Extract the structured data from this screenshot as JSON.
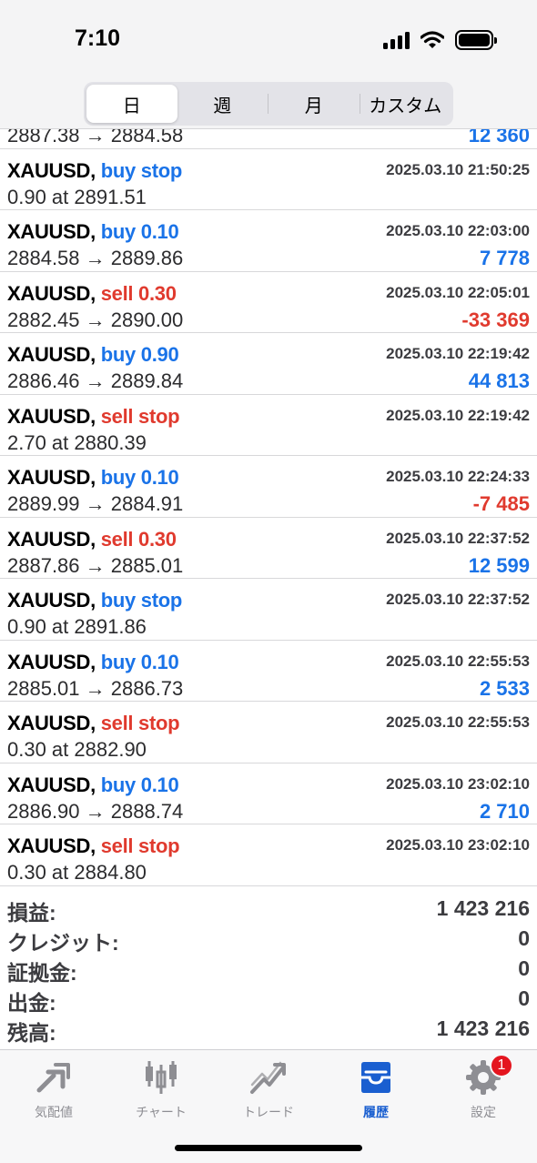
{
  "status_bar": {
    "time": "7:10"
  },
  "segments": [
    {
      "label": "日",
      "active": true
    },
    {
      "label": "週",
      "active": false
    },
    {
      "label": "月",
      "active": false
    },
    {
      "label": "カスタム",
      "active": false
    }
  ],
  "partial_row": {
    "detail": "2887.38 → 2884.58",
    "profit": "12 360"
  },
  "rows": [
    {
      "symbol": "XAUUSD,",
      "side": "buy stop",
      "side_type": "buy",
      "time": "2025.03.10 21:50:25",
      "detail": "0.90 at 2891.51",
      "profit": "",
      "profit_sign": ""
    },
    {
      "symbol": "XAUUSD,",
      "side": "buy 0.10",
      "side_type": "buy",
      "time": "2025.03.10 22:03:00",
      "detail": "2884.58 → 2889.86",
      "profit": "7 778",
      "profit_sign": "pos"
    },
    {
      "symbol": "XAUUSD,",
      "side": "sell 0.30",
      "side_type": "sell",
      "time": "2025.03.10 22:05:01",
      "detail": "2882.45 → 2890.00",
      "profit": "-33 369",
      "profit_sign": "neg"
    },
    {
      "symbol": "XAUUSD,",
      "side": "buy 0.90",
      "side_type": "buy",
      "time": "2025.03.10 22:19:42",
      "detail": "2886.46 → 2889.84",
      "profit": "44 813",
      "profit_sign": "pos"
    },
    {
      "symbol": "XAUUSD,",
      "side": "sell stop",
      "side_type": "sell",
      "time": "2025.03.10 22:19:42",
      "detail": "2.70 at 2880.39",
      "profit": "",
      "profit_sign": ""
    },
    {
      "symbol": "XAUUSD,",
      "side": "buy 0.10",
      "side_type": "buy",
      "time": "2025.03.10 22:24:33",
      "detail": "2889.99 → 2884.91",
      "profit": "-7 485",
      "profit_sign": "neg"
    },
    {
      "symbol": "XAUUSD,",
      "side": "sell 0.30",
      "side_type": "sell",
      "time": "2025.03.10 22:37:52",
      "detail": "2887.86 → 2885.01",
      "profit": "12 599",
      "profit_sign": "pos"
    },
    {
      "symbol": "XAUUSD,",
      "side": "buy stop",
      "side_type": "buy",
      "time": "2025.03.10 22:37:52",
      "detail": "0.90 at 2891.86",
      "profit": "",
      "profit_sign": ""
    },
    {
      "symbol": "XAUUSD,",
      "side": "buy 0.10",
      "side_type": "buy",
      "time": "2025.03.10 22:55:53",
      "detail": "2885.01 → 2886.73",
      "profit": "2 533",
      "profit_sign": "pos"
    },
    {
      "symbol": "XAUUSD,",
      "side": "sell stop",
      "side_type": "sell",
      "time": "2025.03.10 22:55:53",
      "detail": "0.30 at 2882.90",
      "profit": "",
      "profit_sign": ""
    },
    {
      "symbol": "XAUUSD,",
      "side": "buy 0.10",
      "side_type": "buy",
      "time": "2025.03.10 23:02:10",
      "detail": "2886.90 → 2888.74",
      "profit": "2 710",
      "profit_sign": "pos"
    },
    {
      "symbol": "XAUUSD,",
      "side": "sell stop",
      "side_type": "sell",
      "time": "2025.03.10 23:02:10",
      "detail": "0.30 at 2884.80",
      "profit": "",
      "profit_sign": ""
    }
  ],
  "summary": [
    {
      "label": "損益:",
      "value": "1 423 216"
    },
    {
      "label": "クレジット:",
      "value": "0"
    },
    {
      "label": "証拠金:",
      "value": "0"
    },
    {
      "label": "出金:",
      "value": "0"
    },
    {
      "label": "残高:",
      "value": "1 423 216"
    }
  ],
  "tabbar": [
    {
      "label": "気配値",
      "icon": "quotes-arrows-icon",
      "active": false
    },
    {
      "label": "チャート",
      "icon": "candlestick-chart-icon",
      "active": false
    },
    {
      "label": "トレード",
      "icon": "trade-trend-icon",
      "active": false
    },
    {
      "label": "履歴",
      "icon": "history-inbox-icon",
      "active": true
    },
    {
      "label": "設定",
      "icon": "settings-gear-icon",
      "active": false,
      "badge": "1"
    }
  ],
  "colors": {
    "buy": "#1a73e8",
    "sell": "#e03a2e",
    "active_tab": "#1a5fd0",
    "badge": "#e4151f"
  }
}
